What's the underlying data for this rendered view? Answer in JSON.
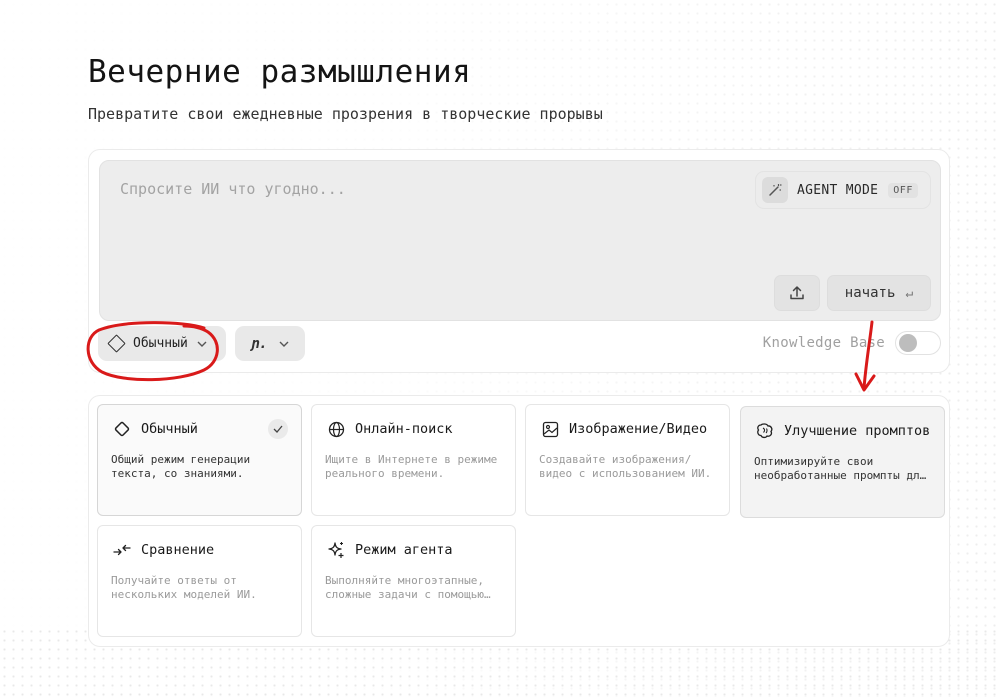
{
  "header": {
    "title": "Вечерние размышления",
    "subtitle": "Превратите свои ежедневные прозрения в творческие прорывы"
  },
  "prompt": {
    "placeholder": "Спросите ИИ что угодно...",
    "agent_mode_label": "AGENT MODE",
    "agent_mode_state": "OFF",
    "upload_icon": "upload-icon",
    "start_label": "начать",
    "enter_glyph": "↵"
  },
  "toolbar": {
    "mode_label": "Обычный",
    "model_logo": "ɲ.",
    "knowledge_base_label": "Knowledge Base",
    "knowledge_base_enabled": false
  },
  "modes": [
    {
      "title": "Обычный",
      "description": "Общий режим генерации текста, со знаниями.",
      "icon": "diamond-icon",
      "selected": true
    },
    {
      "title": "Онлайн-поиск",
      "description": "Ищите в Интернете в режиме реального времени.",
      "icon": "globe-icon",
      "selected": false
    },
    {
      "title": "Изображение/Видео",
      "description": "Создавайте изображения/видео с использованием ИИ.",
      "icon": "image-icon",
      "selected": false
    },
    {
      "title": "Улучшение промптов",
      "description": "Оптимизируйте свои необработанные промпты для ИИ.",
      "icon": "brain-icon",
      "selected": false
    },
    {
      "title": "Сравнение",
      "description": "Получайте ответы от нескольких моделей ИИ.",
      "icon": "compare-icon",
      "selected": false
    },
    {
      "title": "Режим агента",
      "description": "Выполняйте многоэтапные, сложные задачи с помощью ИИ.",
      "icon": "sparkle-icon",
      "selected": false
    }
  ],
  "colors": {
    "annotation_red": "#d91a1a",
    "background": "#ffffff",
    "prompt_bg": "#ededed"
  }
}
